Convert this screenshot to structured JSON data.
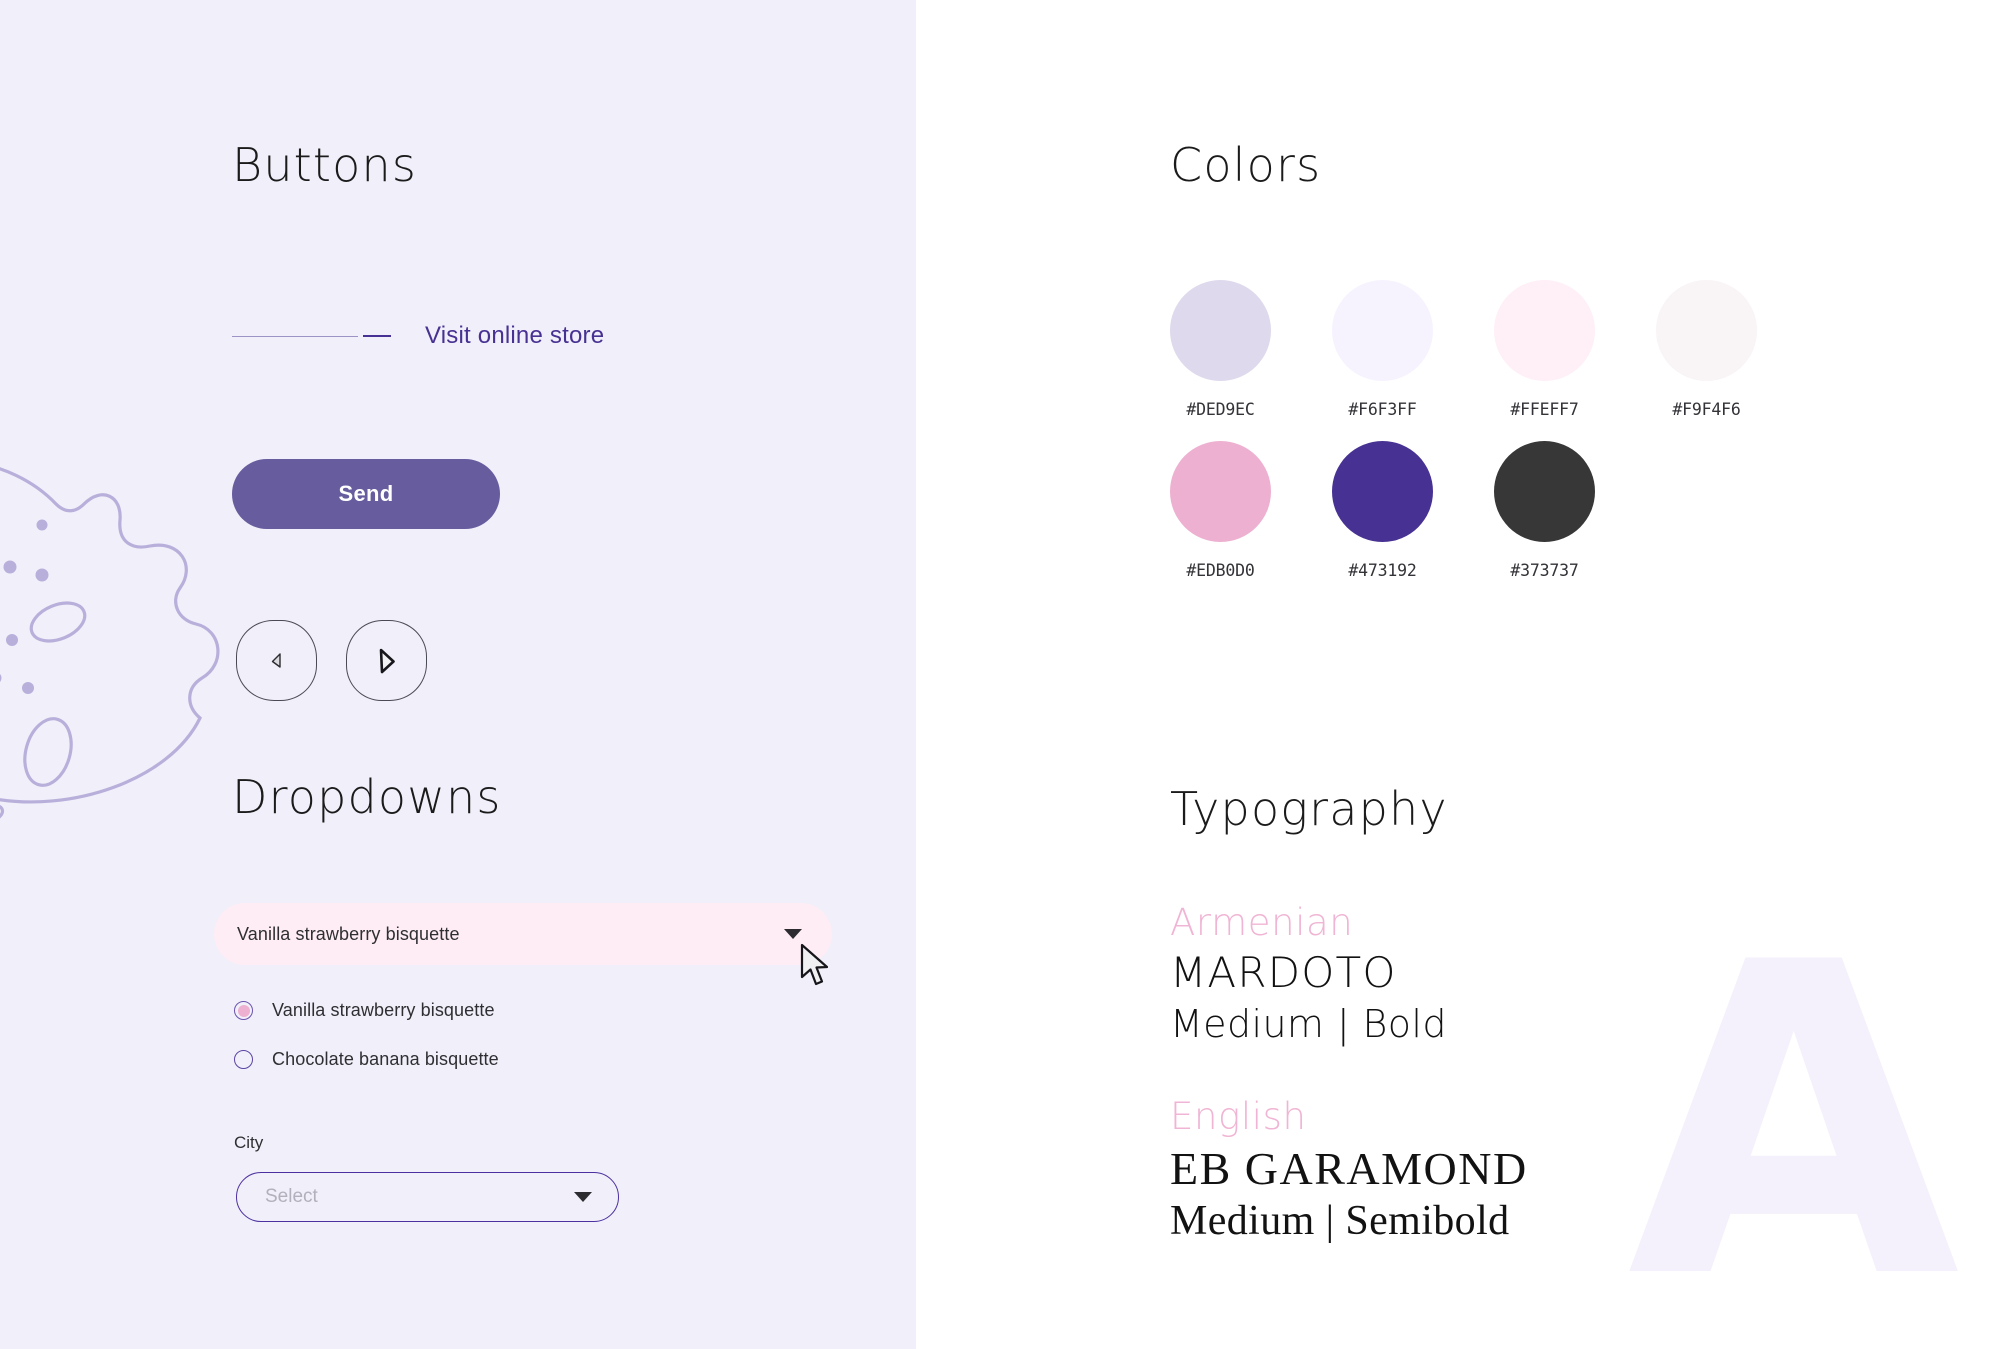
{
  "left": {
    "buttons_section": {
      "title": "Buttons",
      "link_label": "Visit online store",
      "send_label": "Send",
      "prev_icon": "chevron-left-icon",
      "next_icon": "chevron-right-icon"
    },
    "dropdowns_section": {
      "title": "Dropdowns",
      "flavour_select": {
        "value": "Vanilla strawberry bisquette",
        "caret_icon": "caret-down-icon"
      },
      "options": [
        {
          "label": "Vanilla strawberry bisquette",
          "selected": true
        },
        {
          "label": "Chocolate banana bisquette",
          "selected": false
        }
      ],
      "city_field": {
        "label": "City",
        "placeholder": "Select",
        "value": "",
        "caret_icon": "caret-down-icon"
      }
    },
    "decoration_icon": "cookie-illustration"
  },
  "right": {
    "colors_section": {
      "title": "Colors",
      "rows": [
        [
          {
            "hex": "#DED9EC"
          },
          {
            "hex": "#F6F3FF"
          },
          {
            "hex": "#FFEFF7"
          },
          {
            "hex": "#F9F4F6"
          }
        ],
        [
          {
            "hex": "#EDB0D0"
          },
          {
            "hex": "#473192"
          },
          {
            "hex": "#373737"
          }
        ]
      ]
    },
    "typography_section": {
      "title": "Typography",
      "specimens": [
        {
          "language": "Armenian",
          "family": "MARDOTO",
          "weights": "Medium | Bold"
        },
        {
          "language": "English",
          "family": "EB GARAMOND",
          "weights": "Medium | Semibold"
        }
      ],
      "watermark": "A"
    }
  },
  "cursor": {
    "icon": "mouse-pointer-icon"
  }
}
